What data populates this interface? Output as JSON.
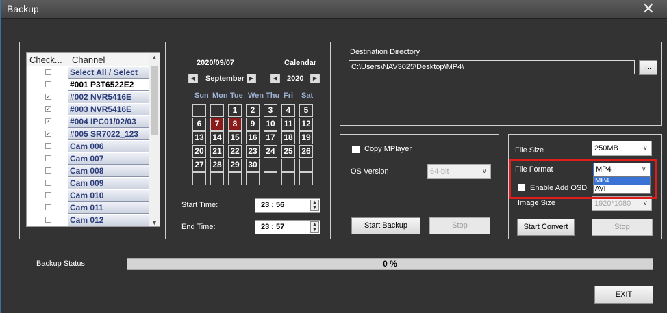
{
  "window": {
    "title": "Backup",
    "close_label": "✕"
  },
  "channels": {
    "headers": [
      "Check...",
      "Channel"
    ],
    "rows": [
      {
        "name": "Select All / Select",
        "checked": false,
        "selected": false
      },
      {
        "name": "#001 P3T6522E2",
        "checked": false,
        "selected": true
      },
      {
        "name": "#002 NVR5416E",
        "checked": true,
        "selected": false
      },
      {
        "name": "#003 NVR5416E",
        "checked": true,
        "selected": false
      },
      {
        "name": "#004 IPC01/02/03",
        "checked": true,
        "selected": false
      },
      {
        "name": "#005 SR7022_123",
        "checked": true,
        "selected": false
      },
      {
        "name": "Cam 006",
        "checked": false,
        "selected": false
      },
      {
        "name": "Cam 007",
        "checked": false,
        "selected": false
      },
      {
        "name": "Cam 008",
        "checked": false,
        "selected": false
      },
      {
        "name": "Cam 009",
        "checked": false,
        "selected": false
      },
      {
        "name": "Cam 010",
        "checked": false,
        "selected": false
      },
      {
        "name": "Cam 011",
        "checked": false,
        "selected": false
      },
      {
        "name": "Cam 012",
        "checked": false,
        "selected": false
      }
    ]
  },
  "calendar": {
    "date": "2020/09/07",
    "label": "Calendar",
    "month": "September",
    "year": "2020",
    "weekdays": [
      "Sun",
      "Mon",
      "Tue",
      "Wen",
      "Thu",
      "Fri",
      "Sat"
    ],
    "weeks": [
      [
        "",
        "",
        "1",
        "2",
        "3",
        "4",
        "5"
      ],
      [
        "6",
        "7",
        "8",
        "9",
        "10",
        "11",
        "12"
      ],
      [
        "13",
        "14",
        "15",
        "16",
        "17",
        "18",
        "19"
      ],
      [
        "20",
        "21",
        "22",
        "23",
        "24",
        "25",
        "26"
      ],
      [
        "27",
        "28",
        "29",
        "30",
        "",
        "",
        ""
      ],
      [
        "",
        "",
        "",
        "",
        "",
        "",
        ""
      ]
    ],
    "highlighted_days": [
      "7",
      "8"
    ],
    "start_time_label": "Start Time:",
    "start_time": "23 : 56",
    "end_time_label": "End Time:",
    "end_time": "23 : 57"
  },
  "destination": {
    "label": "Destination Directory",
    "path": "C:\\Users\\NAV3025\\Desktop\\MP4\\",
    "browse_label": "..."
  },
  "backup": {
    "copy_mplayer_label": "Copy MPlayer",
    "os_version_label": "OS Version",
    "os_version_value": "64-bit",
    "start_label": "Start Backup",
    "stop_label": "Stop"
  },
  "convert": {
    "file_size_label": "File Size",
    "file_size_value": "250MB",
    "file_format_label": "File Format",
    "file_format_value": "MP4",
    "format_options": [
      "MP4",
      "AVI"
    ],
    "enable_osd_label": "Enable Add OSD",
    "image_size_label": "Image Size",
    "image_size_value": "1920*1080",
    "start_label": "Start Convert",
    "stop_label": "Stop"
  },
  "status": {
    "label": "Backup Status",
    "progress_text": "0 %",
    "progress_value": 0
  },
  "exit_label": "EXIT",
  "colors": {
    "highlight_red": "#e01d1d",
    "calendar_red": "#8b1b1b",
    "background": "#333333"
  }
}
